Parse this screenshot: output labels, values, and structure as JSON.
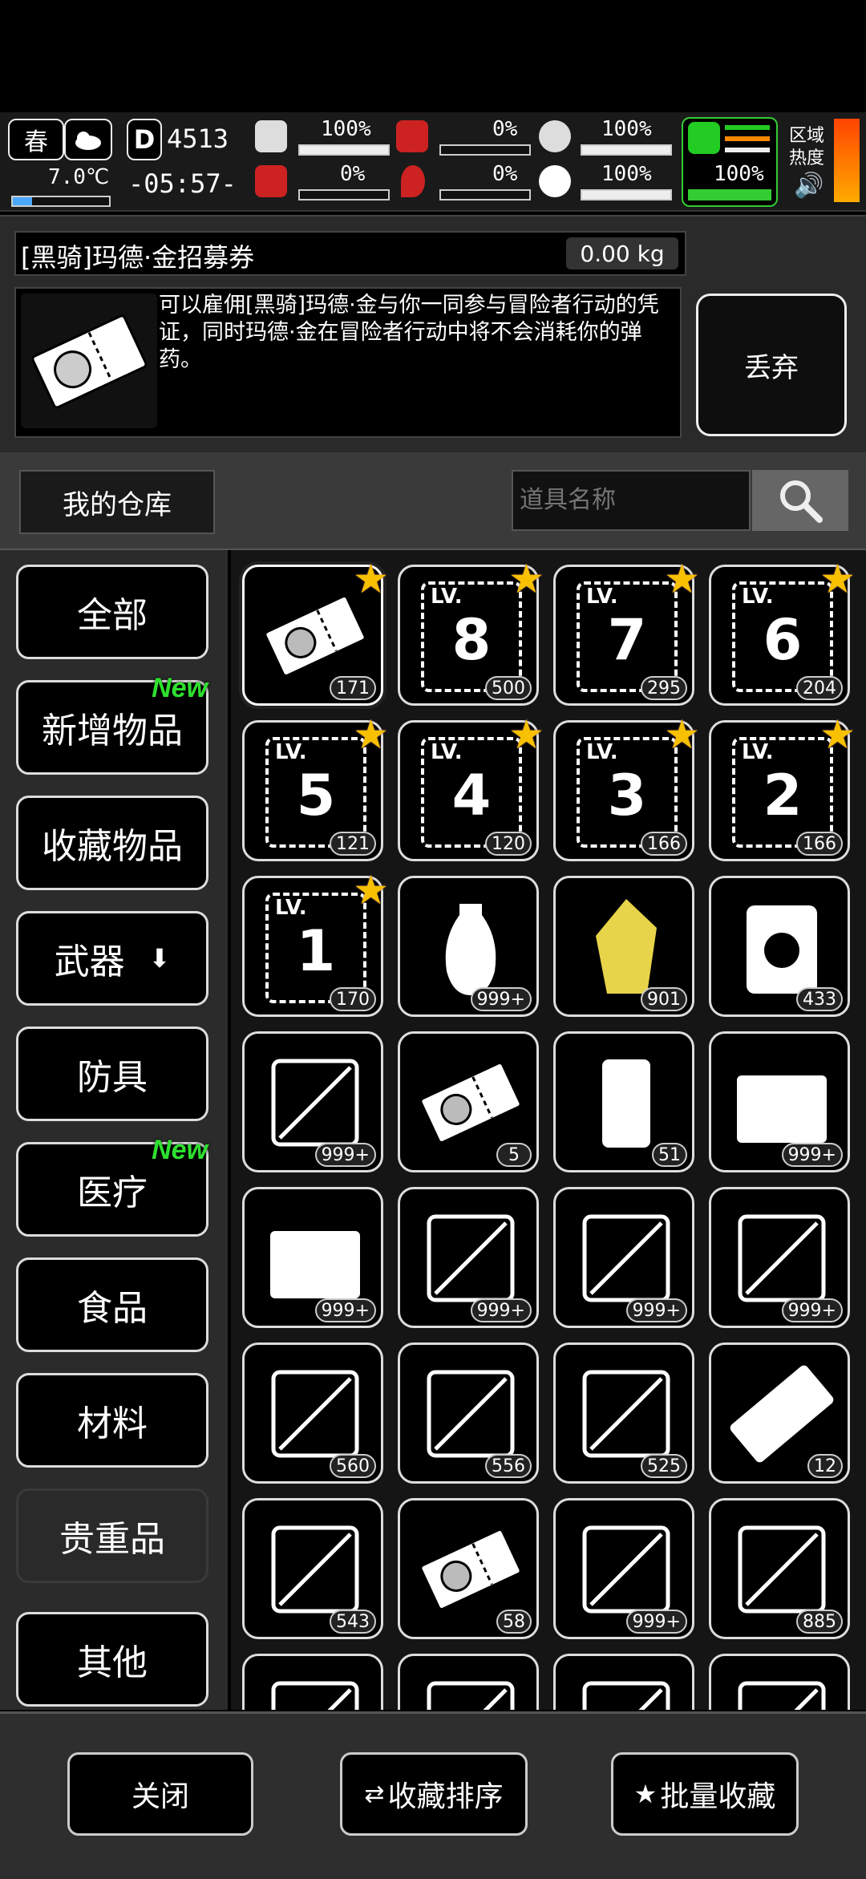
{
  "status": {
    "season": "春",
    "temperature": "7.0℃",
    "day_counter": "4513",
    "time": "-05:57-",
    "stats": [
      {
        "name": "health",
        "pct": "100%"
      },
      {
        "name": "hunger",
        "pct": "0%"
      },
      {
        "name": "armor",
        "pct": "100%"
      },
      {
        "name": "infection",
        "pct": "0%"
      },
      {
        "name": "bleeding",
        "pct": "0%"
      },
      {
        "name": "mood",
        "pct": "100%"
      },
      {
        "name": "stamina",
        "pct": "100%"
      }
    ],
    "region_heat_label": "区域热度"
  },
  "detail": {
    "name": "[黑骑]玛德·金招募券",
    "weight": "0.00 kg",
    "description": "可以雇佣[黑骑]玛德·金与你一同参与冒险者行动的凭证，同时玛德·金在冒险者行动中将不会消耗你的弹药。",
    "discard_label": "丢弃"
  },
  "warehouse": {
    "label": "我的仓库",
    "search_placeholder": "道具名称"
  },
  "categories": [
    {
      "label": "全部",
      "new": false
    },
    {
      "label": "新增物品",
      "new": true
    },
    {
      "label": "收藏物品",
      "new": false
    },
    {
      "label": "武器",
      "new": false
    },
    {
      "label": "防具",
      "new": false
    },
    {
      "label": "医疗",
      "new": true
    },
    {
      "label": "食品",
      "new": false
    },
    {
      "label": "材料",
      "new": false
    },
    {
      "label": "贵重品",
      "new": false
    },
    {
      "label": "其他",
      "new": false
    }
  ],
  "new_tag": "New",
  "items": [
    {
      "icon": "recruit-ticket-icon",
      "count": "171",
      "star": true
    },
    {
      "icon": "lv-ticket-icon",
      "lv": "LV.",
      "num": "8",
      "count": "500",
      "star": true
    },
    {
      "icon": "lv-ticket-icon",
      "lv": "LV.",
      "num": "7",
      "count": "295",
      "star": true
    },
    {
      "icon": "lv-ticket-icon",
      "lv": "LV.",
      "num": "6",
      "count": "204",
      "star": true
    },
    {
      "icon": "lv-ticket-icon",
      "lv": "LV.",
      "num": "5",
      "count": "121",
      "star": true
    },
    {
      "icon": "lv-ticket-icon",
      "lv": "LV.",
      "num": "4",
      "count": "120",
      "star": true
    },
    {
      "icon": "lv-ticket-icon",
      "lv": "LV.",
      "num": "3",
      "count": "166",
      "star": true
    },
    {
      "icon": "lv-ticket-icon",
      "lv": "LV.",
      "num": "2",
      "count": "166",
      "star": true
    },
    {
      "icon": "lv-ticket-icon",
      "lv": "LV.",
      "num": "1",
      "count": "170",
      "star": true
    },
    {
      "icon": "vase-icon",
      "count": "999+",
      "star": false
    },
    {
      "icon": "gold-crystal-icon",
      "count": "901",
      "star": false
    },
    {
      "icon": "coin-bag-icon",
      "count": "433",
      "star": false
    },
    {
      "icon": "flask-i-icon",
      "count": "999+",
      "star": false
    },
    {
      "icon": "recruit-ticket-icon",
      "count": "5",
      "star": false
    },
    {
      "icon": "food-can-icon",
      "count": "51",
      "star": false
    },
    {
      "icon": "supply-chest-icon",
      "count": "999+",
      "star": false
    },
    {
      "icon": "explosive-chest-icon",
      "count": "999+",
      "star": false
    },
    {
      "icon": "map-lv3-icon",
      "count": "999+",
      "star": false
    },
    {
      "icon": "map-lv2-icon",
      "count": "999+",
      "star": false
    },
    {
      "icon": "map-lv1-icon",
      "count": "999+",
      "star": false
    },
    {
      "icon": "device-i-icon",
      "count": "560",
      "star": false
    },
    {
      "icon": "lab-ii-icon",
      "count": "556",
      "star": false
    },
    {
      "icon": "grid-iv-icon",
      "count": "525",
      "star": false
    },
    {
      "icon": "ticket-12-icon",
      "count": "12",
      "star": false
    },
    {
      "icon": "tool-iv-icon",
      "count": "543",
      "star": false
    },
    {
      "icon": "recruit-ticket-icon",
      "count": "58",
      "star": false
    },
    {
      "icon": "flask-iii-icon",
      "count": "999+",
      "star": false
    },
    {
      "icon": "test-tube-iii-icon",
      "count": "885",
      "star": false
    },
    {
      "icon": "syringe-ii-icon",
      "count": "",
      "star": false
    },
    {
      "icon": "syringe-i-icon",
      "count": "",
      "star": false
    },
    {
      "icon": "syringe-iv-icon",
      "count": "",
      "star": false
    },
    {
      "icon": "syringe-v-icon",
      "count": "",
      "star": false
    }
  ],
  "bottom": {
    "close_label": "关闭",
    "sort_label": "收藏排序",
    "batch_label": "批量收藏"
  }
}
